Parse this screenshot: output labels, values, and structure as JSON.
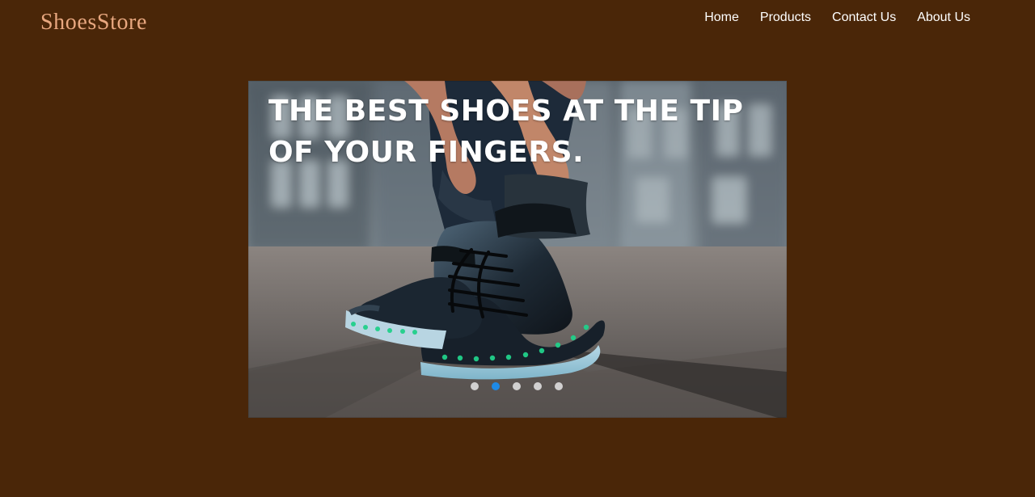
{
  "brand": {
    "name": "ShoesStore"
  },
  "nav": {
    "items": [
      {
        "label": "Home"
      },
      {
        "label": "Products"
      },
      {
        "label": "Contact Us"
      },
      {
        "label": "About Us"
      }
    ]
  },
  "hero": {
    "title": "THE BEST SHOES AT THE TIP OF YOUR FINGERS.",
    "slides_count": 5,
    "active_slide": 2
  },
  "colors": {
    "page_background": "#4a2608",
    "brand_text": "#e8a77f",
    "nav_text": "#ffffff",
    "active_dot": "#1e8ae6",
    "inactive_dot": "#e6e6e6"
  }
}
